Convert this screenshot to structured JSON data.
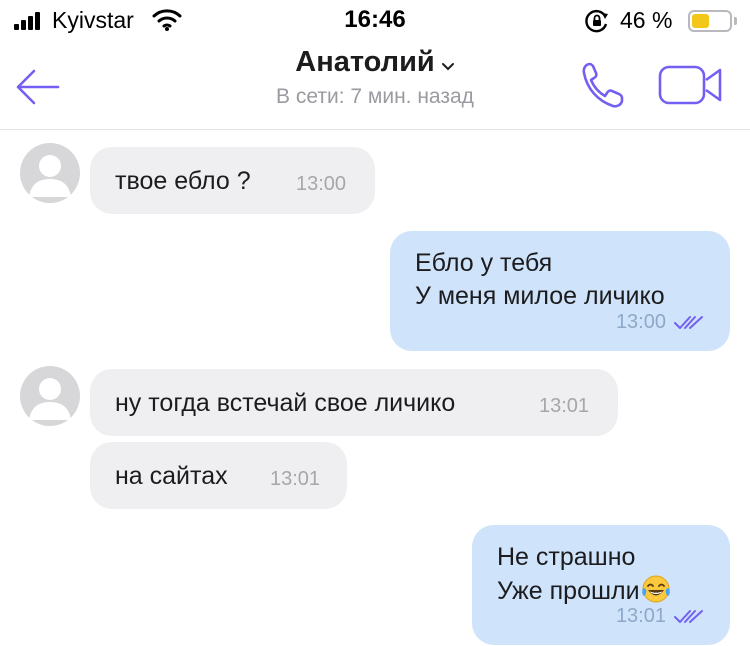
{
  "status_bar": {
    "carrier": "Kyivstar",
    "time": "16:46",
    "battery_percent": "46 %",
    "battery_level": 0.46,
    "icons": [
      "signal-icon",
      "wifi-icon",
      "orientation-lock-icon",
      "battery-icon"
    ]
  },
  "header": {
    "contact_name": "Анатолий",
    "status": "В сети: 7 мин. назад",
    "icons": [
      "back-arrow-icon",
      "chevron-down-icon",
      "phone-icon",
      "video-camera-icon"
    ],
    "accent_color": "#7360f2"
  },
  "messages": [
    {
      "direction": "incoming",
      "text": "твое ебло ?",
      "time": "13:00"
    },
    {
      "direction": "outgoing",
      "lines": [
        "Ебло у тебя",
        "У меня милое личико"
      ],
      "time": "13:00",
      "status": "read"
    },
    {
      "direction": "incoming",
      "text": "ну тогда встечай свое личико",
      "time": "13:01"
    },
    {
      "direction": "incoming",
      "text": "на сайтах",
      "time": "13:01"
    },
    {
      "direction": "outgoing",
      "lines": [
        "Не страшно",
        "Уже прошли"
      ],
      "emoji": "face-with-tears-of-joy-icon",
      "time": "13:01",
      "status": "read"
    }
  ],
  "colors": {
    "incoming_bubble": "#efeff1",
    "outgoing_bubble": "#cfe3fb",
    "read_ticks": "#7360f2"
  }
}
